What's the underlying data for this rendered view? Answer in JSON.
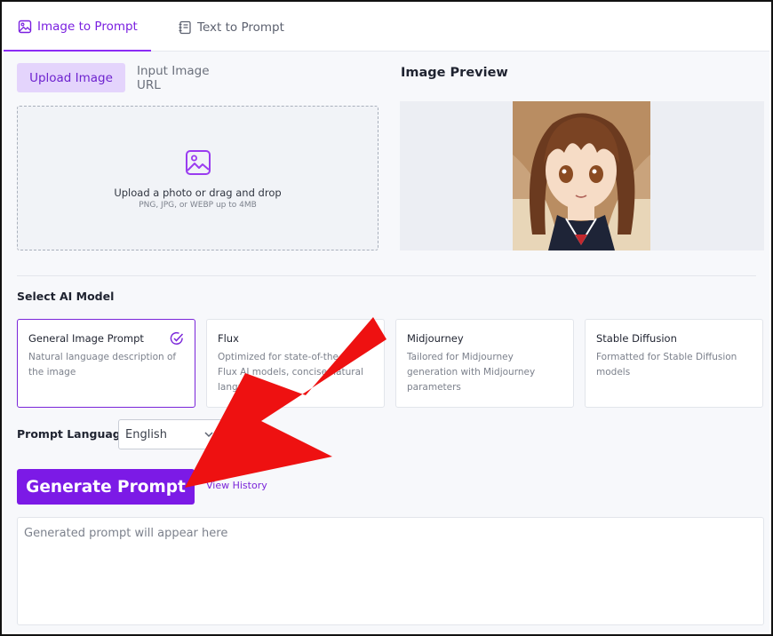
{
  "tabs": [
    {
      "label": "Image to Prompt",
      "active": true
    },
    {
      "label": "Text to Prompt",
      "active": false
    }
  ],
  "source": {
    "upload_label": "Upload Image",
    "url_label": "Input Image URL"
  },
  "dropzone": {
    "main_text": "Upload a photo or drag and drop",
    "sub_text": "PNG, JPG, or WEBP up to 4MB"
  },
  "preview": {
    "title": "Image Preview",
    "image": "anime-girl-portrait"
  },
  "models": {
    "label": "Select AI Model",
    "items": [
      {
        "title": "General Image Prompt",
        "desc": "Natural language description of the image",
        "selected": true
      },
      {
        "title": "Flux",
        "desc": "Optimized for state-of-the-art Flux AI models, concise natural language",
        "selected": false
      },
      {
        "title": "Midjourney",
        "desc": "Tailored for Midjourney generation with Midjourney parameters",
        "selected": false
      },
      {
        "title": "Stable Diffusion",
        "desc": "Formatted for Stable Diffusion models",
        "selected": false
      }
    ]
  },
  "language": {
    "label": "Prompt Language",
    "value": "English"
  },
  "actions": {
    "generate_label": "Generate Prompt",
    "history_label": "View History"
  },
  "output": {
    "placeholder": "Generated prompt will appear here"
  },
  "colors": {
    "accent": "#7c1ae6",
    "accent_light": "#e4d4fc",
    "annotation_arrow": "#ee1111"
  }
}
